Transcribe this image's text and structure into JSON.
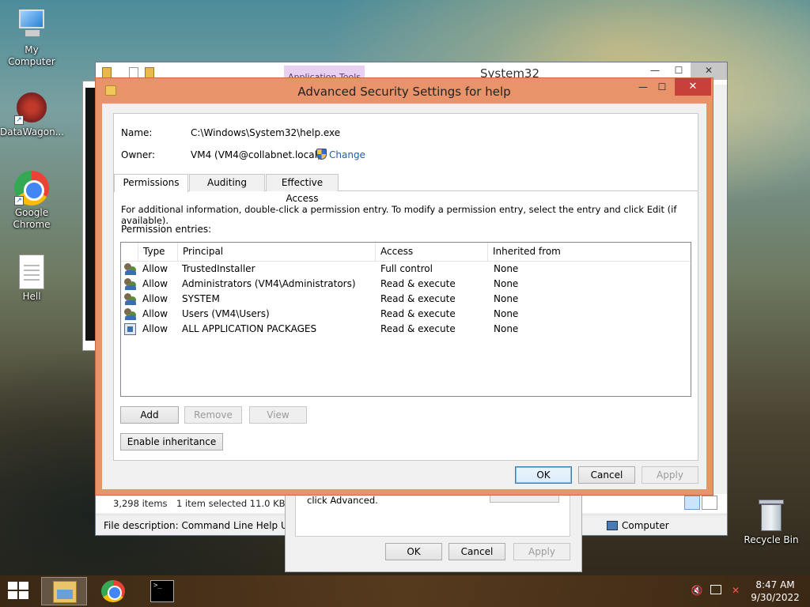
{
  "desktop": {
    "icons": [
      {
        "label": "My Computer",
        "icon": "computer-icon"
      },
      {
        "label": "DataWagon...",
        "icon": "datawagon-icon"
      },
      {
        "label": "Google Chrome",
        "icon": "chrome-icon"
      },
      {
        "label": "Hell",
        "icon": "text-file-icon"
      },
      {
        "label": "Recycle Bin",
        "icon": "recycle-bin-icon"
      }
    ]
  },
  "explorer": {
    "title": "System32",
    "ribbon_context_tab": "Application Tools",
    "status": {
      "item_count": "3,298 items",
      "selected": "1 item selected  11.0 KB"
    },
    "details": {
      "description": "File description: Command Line Help Utility",
      "location": "Computer"
    }
  },
  "properties_dialog": {
    "hint_text": "click Advanced.",
    "buttons": {
      "ok": "OK",
      "cancel": "Cancel",
      "apply": "Apply"
    }
  },
  "security_dialog": {
    "title": "Advanced Security Settings for help",
    "name_label": "Name:",
    "name_value": "C:\\Windows\\System32\\help.exe",
    "owner_label": "Owner:",
    "owner_value": "VM4 (VM4@collabnet.local)",
    "change_link": "Change",
    "tabs": [
      {
        "label": "Permissions",
        "active": true
      },
      {
        "label": "Auditing",
        "active": false
      },
      {
        "label": "Effective Access",
        "active": false
      }
    ],
    "info_text": "For additional information, double-click a permission entry. To modify a permission entry, select the entry and click Edit (if available).",
    "entries_label": "Permission entries:",
    "columns": [
      "Type",
      "Principal",
      "Access",
      "Inherited from"
    ],
    "entries": [
      {
        "icon": "user-group-icon",
        "type": "Allow",
        "principal": "TrustedInstaller",
        "access": "Full control",
        "inherited": "None"
      },
      {
        "icon": "user-group-icon",
        "type": "Allow",
        "principal": "Administrators (VM4\\Administrators)",
        "access": "Read & execute",
        "inherited": "None"
      },
      {
        "icon": "user-group-icon",
        "type": "Allow",
        "principal": "SYSTEM",
        "access": "Read & execute",
        "inherited": "None"
      },
      {
        "icon": "user-group-icon",
        "type": "Allow",
        "principal": "Users (VM4\\Users)",
        "access": "Read & execute",
        "inherited": "None"
      },
      {
        "icon": "app-package-icon",
        "type": "Allow",
        "principal": "ALL APPLICATION PACKAGES",
        "access": "Read & execute",
        "inherited": "None"
      }
    ],
    "buttons": {
      "add": "Add",
      "remove": "Remove",
      "view": "View",
      "enable_inheritance": "Enable inheritance",
      "ok": "OK",
      "cancel": "Cancel",
      "apply": "Apply"
    },
    "accent_color": "#e9936a"
  },
  "taskbar": {
    "apps": [
      {
        "name": "File Explorer",
        "icon": "folder-icon"
      },
      {
        "name": "Google Chrome",
        "icon": "chrome-icon"
      },
      {
        "name": "Command Prompt",
        "icon": "cmd-icon"
      }
    ],
    "time": "8:47 AM",
    "date": "9/30/2022"
  }
}
